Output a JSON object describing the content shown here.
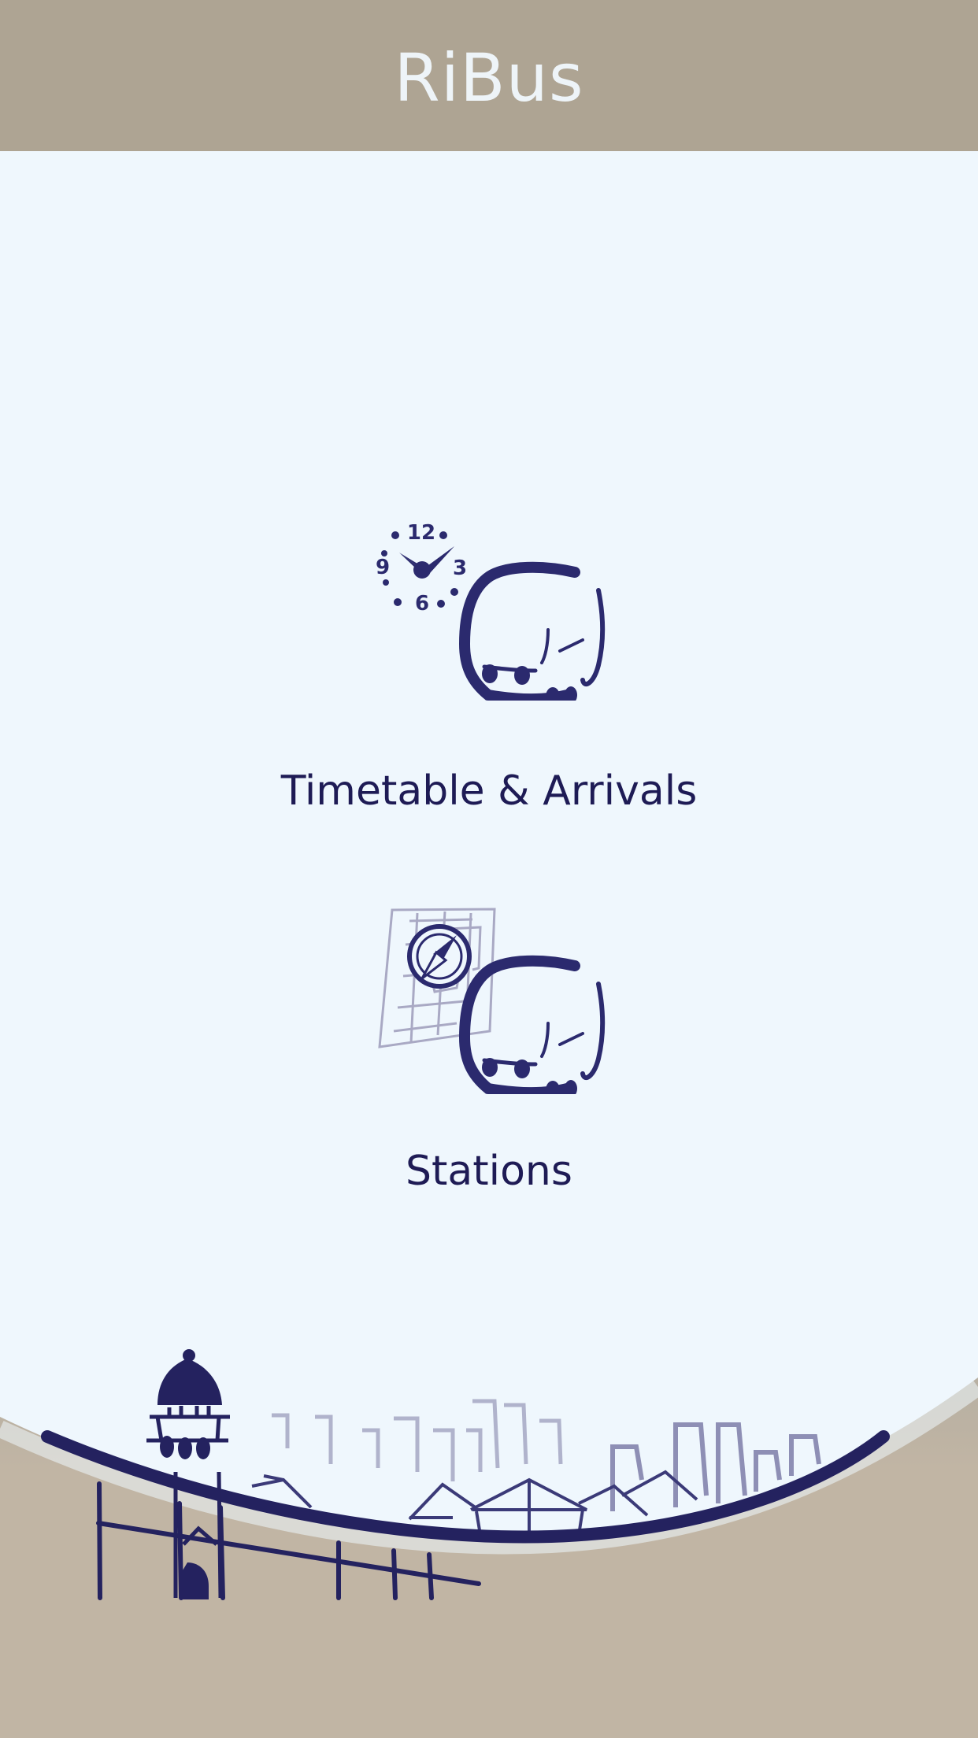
{
  "app": {
    "title": "RiBus"
  },
  "menu": {
    "items": [
      {
        "label": "Timetable & Arrivals",
        "icon": "clock-bus-icon"
      },
      {
        "label": "Stations",
        "icon": "map-compass-bus-icon"
      }
    ]
  },
  "clock": {
    "n12": "12",
    "n3": "3",
    "n6": "6",
    "n9": "9"
  },
  "colors": {
    "header_bg": "#aea493",
    "page_bg": "#eff7fd",
    "accent": "#2b2a6e",
    "text": "#1e1b55",
    "ground": "#c1b5a4"
  }
}
